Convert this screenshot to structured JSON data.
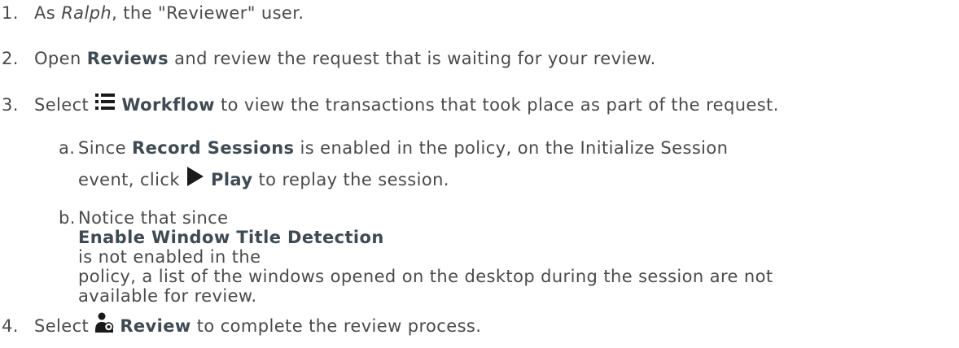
{
  "steps": {
    "s1": {
      "num": "1.",
      "pre": "As ",
      "name": "Ralph",
      "post": ", the \"Reviewer\" user."
    },
    "s2": {
      "num": "2.",
      "pre": "Open ",
      "bold": "Reviews",
      "post": " and review the request that is waiting for your review."
    },
    "s3": {
      "num": "3.",
      "pre": "Select ",
      "icon": "list-icon",
      "bold": "Workflow",
      "post": " to view the transactions that took place as part of the request."
    },
    "s3a": {
      "letter": "a.",
      "pre": "Since ",
      "bold": "Record Sessions",
      "post": " is enabled in the policy, on the Initialize Session",
      "line2_pre": "event, click ",
      "icon": "play-icon",
      "bold2": "Play",
      "line2_post": " to replay the session."
    },
    "s3b": {
      "letter": "b.",
      "pre": "Notice that since ",
      "bold": "Enable Window Title Detection",
      "post": " is not enabled in the",
      "line2": "policy, a list of the windows opened on the desktop during the session are not",
      "line3": "available for review."
    },
    "s4": {
      "num": "4.",
      "pre": "Select ",
      "icon": "reviewer-icon",
      "bold": "Review",
      "post": " to complete the review process."
    }
  }
}
